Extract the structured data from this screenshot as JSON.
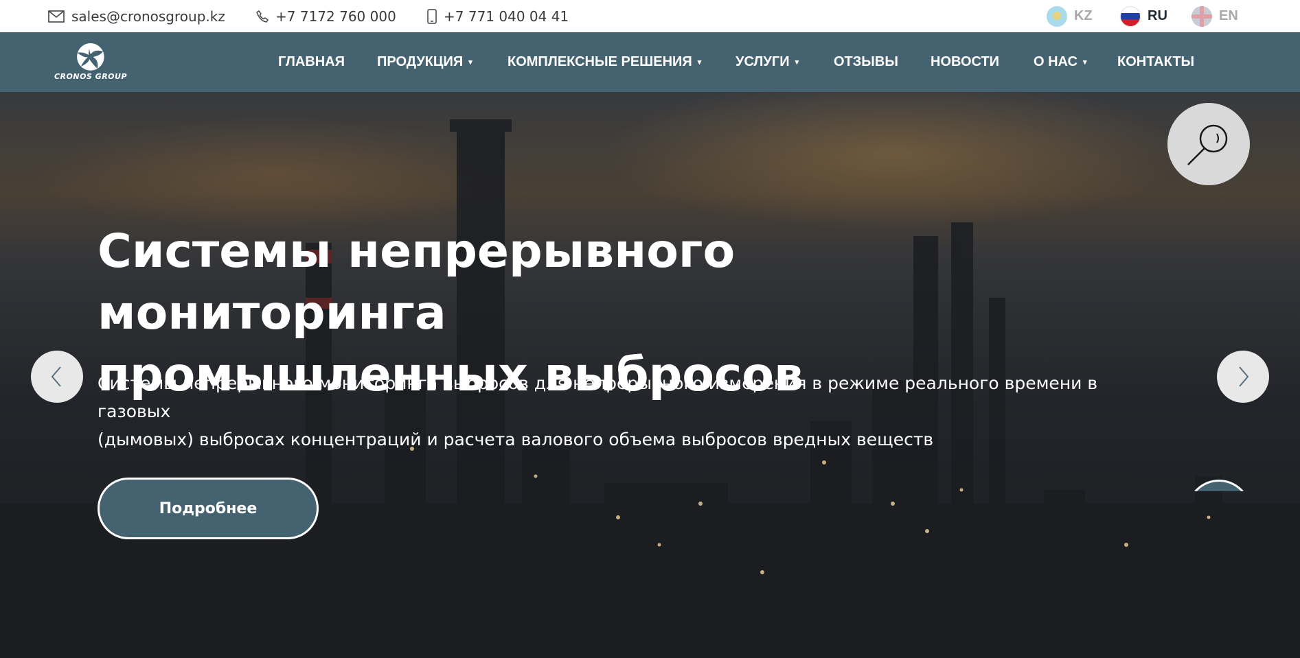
{
  "topbar": {
    "email": "sales@cronosgroup.kz",
    "phone": "+7 7172 760 000",
    "mobile": "+7 771 040 04 41",
    "icons": {
      "email": "envelope-icon",
      "phone": "phone-icon",
      "mobile": "mobile-phone-icon"
    },
    "languages": [
      {
        "code": "KZ",
        "active": false
      },
      {
        "code": "RU",
        "active": true
      },
      {
        "code": "EN",
        "active": false
      }
    ]
  },
  "nav": {
    "logo_text": "CRONOS GROUP",
    "items": [
      {
        "label": "ГЛАВНАЯ",
        "has_dropdown": false
      },
      {
        "label": "ПРОДУКЦИЯ",
        "has_dropdown": true
      },
      {
        "label": "КОМПЛЕКСНЫЕ РЕШЕНИЯ",
        "has_dropdown": true
      },
      {
        "label": "УСЛУГИ",
        "has_dropdown": true
      },
      {
        "label": "ОТЗЫВЫ",
        "has_dropdown": false
      },
      {
        "label": "НОВОСТИ",
        "has_dropdown": false
      },
      {
        "label": "О НАС",
        "has_dropdown": true
      },
      {
        "label": "КОНТАКТЫ",
        "has_dropdown": false
      }
    ],
    "caret": "▾"
  },
  "hero": {
    "title_line1": "Системы непрерывного мониторинга",
    "title_line2": "промышленных выбросов",
    "subtitle_line1": "Системы непрерывного мониторинга выбросов для непрерывного измерения в режиме реального времени в газовых",
    "subtitle_line2": "(дымовых) выбросах концентраций и расчета валового объема выбросов вредных веществ",
    "button_label": "Подробнее"
  },
  "colors": {
    "brand": "#446270",
    "topbar_bg": "#ffffff",
    "hero_text": "#ffffff",
    "lang_inactive": "#a9a9a9",
    "lang_active": "#1e2b33"
  }
}
